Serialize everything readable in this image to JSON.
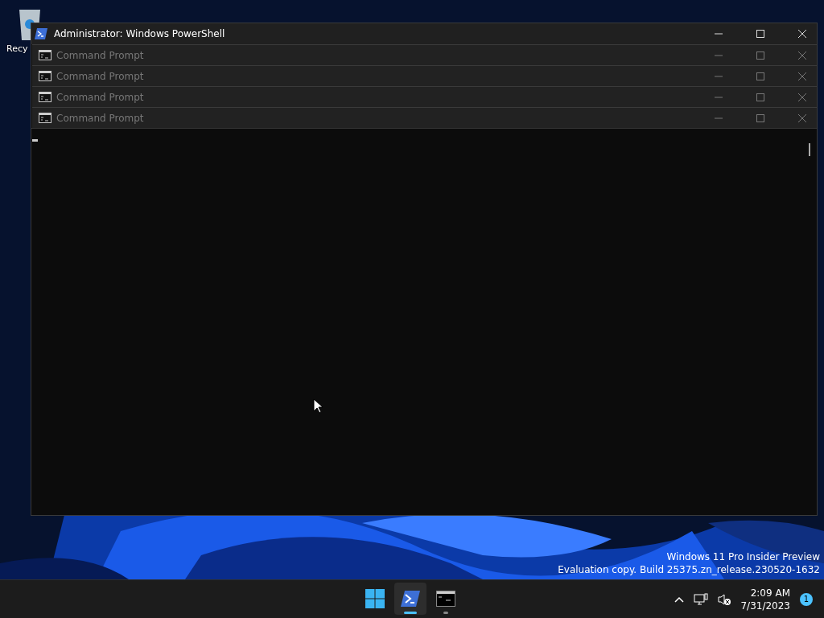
{
  "desktop": {
    "icons": [
      {
        "label": "Recy"
      }
    ]
  },
  "powershell_window": {
    "title": "Administrator: Windows PowerShell"
  },
  "stacked_windows": [
    {
      "title": "Command Prompt"
    },
    {
      "title": "Command Prompt"
    },
    {
      "title": "Command Prompt"
    },
    {
      "title": "Command Prompt"
    }
  ],
  "evaluation_notice": [
    "Windows 11 Pro Insider Preview",
    "Evaluation copy. Build 25375.zn_release.230520-1632"
  ],
  "taskbar": {
    "apps": [
      {
        "kind": "start",
        "selected": false
      },
      {
        "kind": "powershell",
        "selected": true
      },
      {
        "kind": "cmd",
        "selected": false
      }
    ],
    "time": "2:09 AM",
    "date": "7/31/2023",
    "notification_count": "1"
  }
}
